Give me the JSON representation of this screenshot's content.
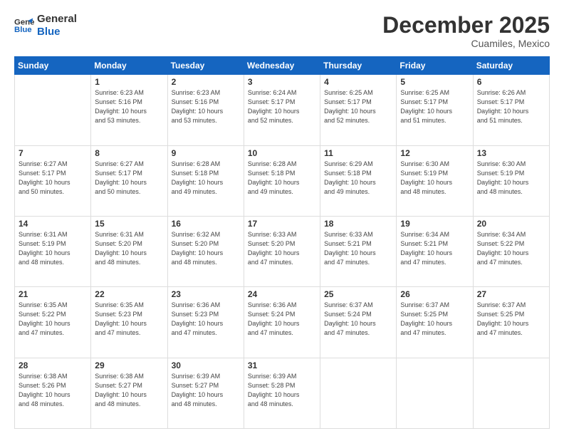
{
  "logo": {
    "line1": "General",
    "line2": "Blue"
  },
  "title": "December 2025",
  "subtitle": "Cuamiles, Mexico",
  "header": {
    "days": [
      "Sunday",
      "Monday",
      "Tuesday",
      "Wednesday",
      "Thursday",
      "Friday",
      "Saturday"
    ]
  },
  "weeks": [
    {
      "cells": [
        {
          "day": "",
          "info": ""
        },
        {
          "day": "1",
          "info": "Sunrise: 6:23 AM\nSunset: 5:16 PM\nDaylight: 10 hours\nand 53 minutes."
        },
        {
          "day": "2",
          "info": "Sunrise: 6:23 AM\nSunset: 5:16 PM\nDaylight: 10 hours\nand 53 minutes."
        },
        {
          "day": "3",
          "info": "Sunrise: 6:24 AM\nSunset: 5:17 PM\nDaylight: 10 hours\nand 52 minutes."
        },
        {
          "day": "4",
          "info": "Sunrise: 6:25 AM\nSunset: 5:17 PM\nDaylight: 10 hours\nand 52 minutes."
        },
        {
          "day": "5",
          "info": "Sunrise: 6:25 AM\nSunset: 5:17 PM\nDaylight: 10 hours\nand 51 minutes."
        },
        {
          "day": "6",
          "info": "Sunrise: 6:26 AM\nSunset: 5:17 PM\nDaylight: 10 hours\nand 51 minutes."
        }
      ]
    },
    {
      "cells": [
        {
          "day": "7",
          "info": "Sunrise: 6:27 AM\nSunset: 5:17 PM\nDaylight: 10 hours\nand 50 minutes."
        },
        {
          "day": "8",
          "info": "Sunrise: 6:27 AM\nSunset: 5:17 PM\nDaylight: 10 hours\nand 50 minutes."
        },
        {
          "day": "9",
          "info": "Sunrise: 6:28 AM\nSunset: 5:18 PM\nDaylight: 10 hours\nand 49 minutes."
        },
        {
          "day": "10",
          "info": "Sunrise: 6:28 AM\nSunset: 5:18 PM\nDaylight: 10 hours\nand 49 minutes."
        },
        {
          "day": "11",
          "info": "Sunrise: 6:29 AM\nSunset: 5:18 PM\nDaylight: 10 hours\nand 49 minutes."
        },
        {
          "day": "12",
          "info": "Sunrise: 6:30 AM\nSunset: 5:19 PM\nDaylight: 10 hours\nand 48 minutes."
        },
        {
          "day": "13",
          "info": "Sunrise: 6:30 AM\nSunset: 5:19 PM\nDaylight: 10 hours\nand 48 minutes."
        }
      ]
    },
    {
      "cells": [
        {
          "day": "14",
          "info": "Sunrise: 6:31 AM\nSunset: 5:19 PM\nDaylight: 10 hours\nand 48 minutes."
        },
        {
          "day": "15",
          "info": "Sunrise: 6:31 AM\nSunset: 5:20 PM\nDaylight: 10 hours\nand 48 minutes."
        },
        {
          "day": "16",
          "info": "Sunrise: 6:32 AM\nSunset: 5:20 PM\nDaylight: 10 hours\nand 48 minutes."
        },
        {
          "day": "17",
          "info": "Sunrise: 6:33 AM\nSunset: 5:20 PM\nDaylight: 10 hours\nand 47 minutes."
        },
        {
          "day": "18",
          "info": "Sunrise: 6:33 AM\nSunset: 5:21 PM\nDaylight: 10 hours\nand 47 minutes."
        },
        {
          "day": "19",
          "info": "Sunrise: 6:34 AM\nSunset: 5:21 PM\nDaylight: 10 hours\nand 47 minutes."
        },
        {
          "day": "20",
          "info": "Sunrise: 6:34 AM\nSunset: 5:22 PM\nDaylight: 10 hours\nand 47 minutes."
        }
      ]
    },
    {
      "cells": [
        {
          "day": "21",
          "info": "Sunrise: 6:35 AM\nSunset: 5:22 PM\nDaylight: 10 hours\nand 47 minutes."
        },
        {
          "day": "22",
          "info": "Sunrise: 6:35 AM\nSunset: 5:23 PM\nDaylight: 10 hours\nand 47 minutes."
        },
        {
          "day": "23",
          "info": "Sunrise: 6:36 AM\nSunset: 5:23 PM\nDaylight: 10 hours\nand 47 minutes."
        },
        {
          "day": "24",
          "info": "Sunrise: 6:36 AM\nSunset: 5:24 PM\nDaylight: 10 hours\nand 47 minutes."
        },
        {
          "day": "25",
          "info": "Sunrise: 6:37 AM\nSunset: 5:24 PM\nDaylight: 10 hours\nand 47 minutes."
        },
        {
          "day": "26",
          "info": "Sunrise: 6:37 AM\nSunset: 5:25 PM\nDaylight: 10 hours\nand 47 minutes."
        },
        {
          "day": "27",
          "info": "Sunrise: 6:37 AM\nSunset: 5:25 PM\nDaylight: 10 hours\nand 47 minutes."
        }
      ]
    },
    {
      "cells": [
        {
          "day": "28",
          "info": "Sunrise: 6:38 AM\nSunset: 5:26 PM\nDaylight: 10 hours\nand 48 minutes."
        },
        {
          "day": "29",
          "info": "Sunrise: 6:38 AM\nSunset: 5:27 PM\nDaylight: 10 hours\nand 48 minutes."
        },
        {
          "day": "30",
          "info": "Sunrise: 6:39 AM\nSunset: 5:27 PM\nDaylight: 10 hours\nand 48 minutes."
        },
        {
          "day": "31",
          "info": "Sunrise: 6:39 AM\nSunset: 5:28 PM\nDaylight: 10 hours\nand 48 minutes."
        },
        {
          "day": "",
          "info": ""
        },
        {
          "day": "",
          "info": ""
        },
        {
          "day": "",
          "info": ""
        }
      ]
    }
  ]
}
